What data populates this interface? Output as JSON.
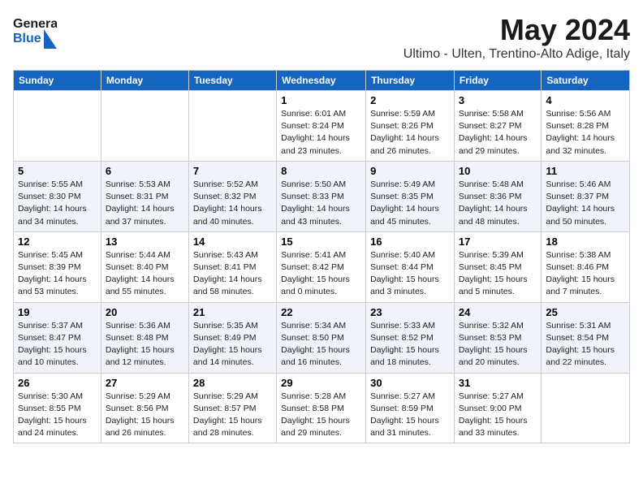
{
  "header": {
    "logo_line1": "General",
    "logo_line2": "Blue",
    "month_year": "May 2024",
    "location": "Ultimo - Ulten, Trentino-Alto Adige, Italy"
  },
  "days_of_week": [
    "Sunday",
    "Monday",
    "Tuesday",
    "Wednesday",
    "Thursday",
    "Friday",
    "Saturday"
  ],
  "weeks": [
    [
      {
        "day": "",
        "info": ""
      },
      {
        "day": "",
        "info": ""
      },
      {
        "day": "",
        "info": ""
      },
      {
        "day": "1",
        "info": "Sunrise: 6:01 AM\nSunset: 8:24 PM\nDaylight: 14 hours\nand 23 minutes."
      },
      {
        "day": "2",
        "info": "Sunrise: 5:59 AM\nSunset: 8:26 PM\nDaylight: 14 hours\nand 26 minutes."
      },
      {
        "day": "3",
        "info": "Sunrise: 5:58 AM\nSunset: 8:27 PM\nDaylight: 14 hours\nand 29 minutes."
      },
      {
        "day": "4",
        "info": "Sunrise: 5:56 AM\nSunset: 8:28 PM\nDaylight: 14 hours\nand 32 minutes."
      }
    ],
    [
      {
        "day": "5",
        "info": "Sunrise: 5:55 AM\nSunset: 8:30 PM\nDaylight: 14 hours\nand 34 minutes."
      },
      {
        "day": "6",
        "info": "Sunrise: 5:53 AM\nSunset: 8:31 PM\nDaylight: 14 hours\nand 37 minutes."
      },
      {
        "day": "7",
        "info": "Sunrise: 5:52 AM\nSunset: 8:32 PM\nDaylight: 14 hours\nand 40 minutes."
      },
      {
        "day": "8",
        "info": "Sunrise: 5:50 AM\nSunset: 8:33 PM\nDaylight: 14 hours\nand 43 minutes."
      },
      {
        "day": "9",
        "info": "Sunrise: 5:49 AM\nSunset: 8:35 PM\nDaylight: 14 hours\nand 45 minutes."
      },
      {
        "day": "10",
        "info": "Sunrise: 5:48 AM\nSunset: 8:36 PM\nDaylight: 14 hours\nand 48 minutes."
      },
      {
        "day": "11",
        "info": "Sunrise: 5:46 AM\nSunset: 8:37 PM\nDaylight: 14 hours\nand 50 minutes."
      }
    ],
    [
      {
        "day": "12",
        "info": "Sunrise: 5:45 AM\nSunset: 8:39 PM\nDaylight: 14 hours\nand 53 minutes."
      },
      {
        "day": "13",
        "info": "Sunrise: 5:44 AM\nSunset: 8:40 PM\nDaylight: 14 hours\nand 55 minutes."
      },
      {
        "day": "14",
        "info": "Sunrise: 5:43 AM\nSunset: 8:41 PM\nDaylight: 14 hours\nand 58 minutes."
      },
      {
        "day": "15",
        "info": "Sunrise: 5:41 AM\nSunset: 8:42 PM\nDaylight: 15 hours\nand 0 minutes."
      },
      {
        "day": "16",
        "info": "Sunrise: 5:40 AM\nSunset: 8:44 PM\nDaylight: 15 hours\nand 3 minutes."
      },
      {
        "day": "17",
        "info": "Sunrise: 5:39 AM\nSunset: 8:45 PM\nDaylight: 15 hours\nand 5 minutes."
      },
      {
        "day": "18",
        "info": "Sunrise: 5:38 AM\nSunset: 8:46 PM\nDaylight: 15 hours\nand 7 minutes."
      }
    ],
    [
      {
        "day": "19",
        "info": "Sunrise: 5:37 AM\nSunset: 8:47 PM\nDaylight: 15 hours\nand 10 minutes."
      },
      {
        "day": "20",
        "info": "Sunrise: 5:36 AM\nSunset: 8:48 PM\nDaylight: 15 hours\nand 12 minutes."
      },
      {
        "day": "21",
        "info": "Sunrise: 5:35 AM\nSunset: 8:49 PM\nDaylight: 15 hours\nand 14 minutes."
      },
      {
        "day": "22",
        "info": "Sunrise: 5:34 AM\nSunset: 8:50 PM\nDaylight: 15 hours\nand 16 minutes."
      },
      {
        "day": "23",
        "info": "Sunrise: 5:33 AM\nSunset: 8:52 PM\nDaylight: 15 hours\nand 18 minutes."
      },
      {
        "day": "24",
        "info": "Sunrise: 5:32 AM\nSunset: 8:53 PM\nDaylight: 15 hours\nand 20 minutes."
      },
      {
        "day": "25",
        "info": "Sunrise: 5:31 AM\nSunset: 8:54 PM\nDaylight: 15 hours\nand 22 minutes."
      }
    ],
    [
      {
        "day": "26",
        "info": "Sunrise: 5:30 AM\nSunset: 8:55 PM\nDaylight: 15 hours\nand 24 minutes."
      },
      {
        "day": "27",
        "info": "Sunrise: 5:29 AM\nSunset: 8:56 PM\nDaylight: 15 hours\nand 26 minutes."
      },
      {
        "day": "28",
        "info": "Sunrise: 5:29 AM\nSunset: 8:57 PM\nDaylight: 15 hours\nand 28 minutes."
      },
      {
        "day": "29",
        "info": "Sunrise: 5:28 AM\nSunset: 8:58 PM\nDaylight: 15 hours\nand 29 minutes."
      },
      {
        "day": "30",
        "info": "Sunrise: 5:27 AM\nSunset: 8:59 PM\nDaylight: 15 hours\nand 31 minutes."
      },
      {
        "day": "31",
        "info": "Sunrise: 5:27 AM\nSunset: 9:00 PM\nDaylight: 15 hours\nand 33 minutes."
      },
      {
        "day": "",
        "info": ""
      }
    ]
  ]
}
